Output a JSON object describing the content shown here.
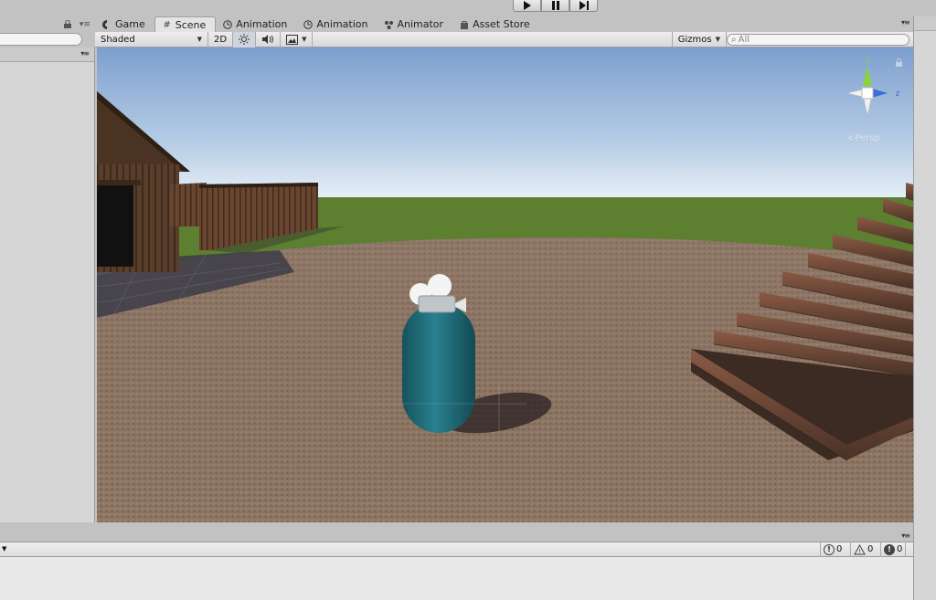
{
  "playbar": {
    "play": "play",
    "pause": "pause",
    "step": "step"
  },
  "tabs": [
    {
      "label": "Game",
      "icon": "game-icon"
    },
    {
      "label": "Scene",
      "icon": "scene-grid-icon",
      "active": true
    },
    {
      "label": "Animation",
      "icon": "animation-clock-icon"
    },
    {
      "label": "Animation",
      "icon": "animation-clock-icon"
    },
    {
      "label": "Animator",
      "icon": "animator-icon"
    },
    {
      "label": "Asset Store",
      "icon": "store-bag-icon"
    }
  ],
  "scene_toolbar": {
    "shading_mode": "Shaded",
    "mode_2d": "2D",
    "gizmos": "Gizmos",
    "search_placeholder": "All"
  },
  "gizmo": {
    "y_axis": "y",
    "z_axis": "z",
    "projection": "Persp"
  },
  "console": {
    "errors": "0",
    "warnings": "0",
    "messages": "0"
  },
  "colors": {
    "sky_top": "#7d9fcf",
    "sky_bottom": "#e9f1f8",
    "grass": "#5c7f30",
    "ground": "#8c7462",
    "capsule": "#1f6b74"
  }
}
